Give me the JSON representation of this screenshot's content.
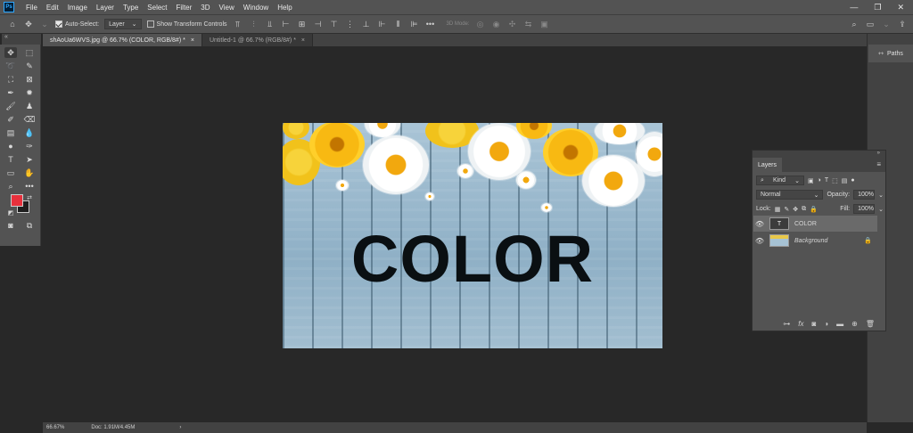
{
  "menubar": {
    "app_icon": "Ps",
    "items": [
      "File",
      "Edit",
      "Image",
      "Layer",
      "Type",
      "Select",
      "Filter",
      "3D",
      "View",
      "Window",
      "Help"
    ],
    "window_controls": [
      "—",
      "❐",
      "✕"
    ]
  },
  "options": {
    "auto_select_label": "Auto-Select:",
    "auto_select_value": "Layer",
    "transform_label": "Show Transform Controls",
    "mode_3d_label": "3D Mode:"
  },
  "tabs": [
    {
      "label": "shAoUa6WVS.jpg @ 66.7% (COLOR, RGB/8#) *",
      "close": "×"
    },
    {
      "label": "Untitled-1 @ 66.7% (RGB/8#) *",
      "close": "×"
    }
  ],
  "document": {
    "text_layer_content": "COLOR"
  },
  "right_dock": {
    "paths_label": "Paths"
  },
  "layers_panel": {
    "tab_label": "Layers",
    "filter_kind": "Kind",
    "blend_mode": "Normal",
    "opacity_label": "Opacity:",
    "opacity_value": "100%",
    "lock_label": "Lock:",
    "fill_label": "Fill:",
    "fill_value": "100%",
    "layers": [
      {
        "name": "COLOR",
        "type": "text",
        "thumb": "T"
      },
      {
        "name": "Background",
        "type": "image",
        "locked": true
      }
    ]
  },
  "status": {
    "zoom": "66.67%",
    "doc_info": "Doc: 1.91M/4.45M",
    "arrow": "›"
  },
  "colors": {
    "foreground": "#e8303c",
    "background": "#1f1f1f"
  }
}
